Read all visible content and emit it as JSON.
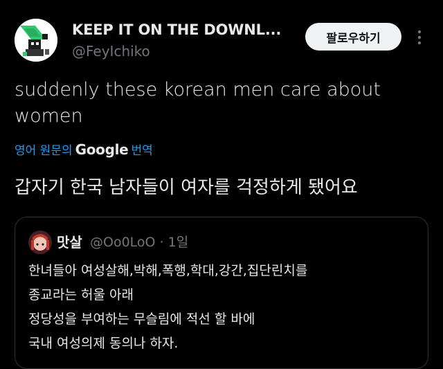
{
  "author": {
    "display_name": "KEEP IT ON THE DOWNL...",
    "handle": "@FeyIchiko",
    "avatar_icon": "pixel-art-avatar"
  },
  "actions": {
    "follow_label": "팔로우하기",
    "more_icon": "more-vertical-icon"
  },
  "tweet": {
    "text": "suddenly these korean men care about women",
    "translate_prefix": "영어 원문의",
    "translate_brand": "Google",
    "translate_suffix": "번역",
    "translated_text": "갑자기 한국 남자들이 여자를 걱정하게 됐어요"
  },
  "quote": {
    "name": "맛살",
    "handle_time": "@Oo0LoO · 1일",
    "lines": [
      "한녀들아 여성살해,박해,폭행,학대,강간,집단린치를",
      "종교라는 허울 아래",
      "정당성을 부여하는 무슬림에 적선 할 바에",
      "국내 여성의제 동의나 하자."
    ]
  },
  "colors": {
    "background": "#000000",
    "text": "#e7e9ea",
    "muted": "#71767b",
    "link": "#1d9bf0",
    "border": "#2f3336",
    "button_bg": "#eff3f4"
  }
}
